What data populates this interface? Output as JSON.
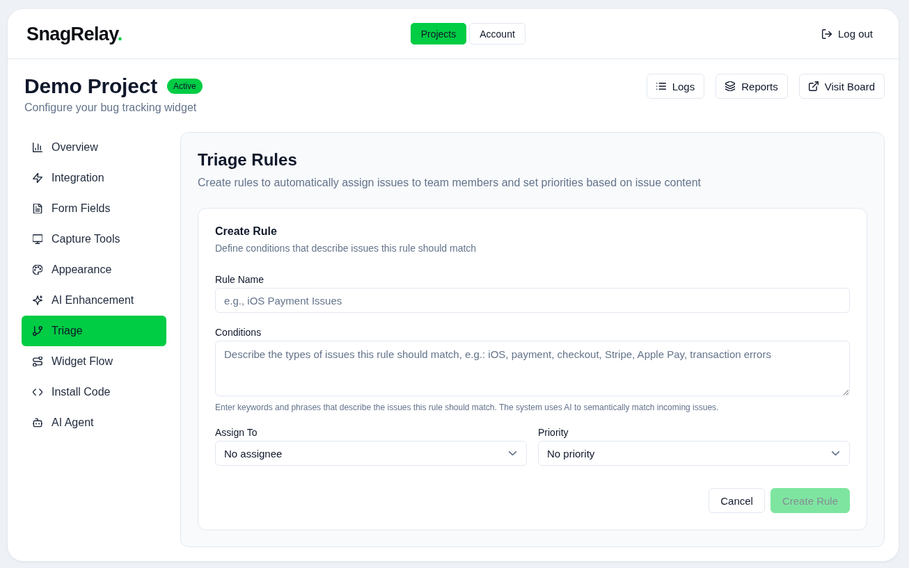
{
  "header": {
    "logo": {
      "name": "SnagRelay",
      "dot": "."
    },
    "nav_tabs": [
      {
        "label": "Projects",
        "selected": true
      },
      {
        "label": "Account",
        "selected": false
      }
    ],
    "logout": "Log out"
  },
  "project": {
    "title": "Demo Project",
    "status": "Active",
    "subtitle": "Configure your bug tracking widget",
    "actions": [
      "Logs",
      "Reports",
      "Visit Board"
    ]
  },
  "sidebar": {
    "items": [
      {
        "label": "Overview",
        "selected": false
      },
      {
        "label": "Integration",
        "selected": false
      },
      {
        "label": "Form Fields",
        "selected": false
      },
      {
        "label": "Capture Tools",
        "selected": false
      },
      {
        "label": "Appearance",
        "selected": false
      },
      {
        "label": "AI Enhancement",
        "selected": false
      },
      {
        "label": "Triage",
        "selected": true
      },
      {
        "label": "Widget Flow",
        "selected": false
      },
      {
        "label": "Install Code",
        "selected": false
      },
      {
        "label": "AI Agent",
        "selected": false
      }
    ]
  },
  "panel": {
    "title": "Triage Rules",
    "subtitle": "Create rules to automatically assign issues to team members and set priorities based on issue content",
    "form": {
      "title": "Create Rule",
      "subtitle": "Define conditions that describe issues this rule should match",
      "fields": [
        {
          "kind": "input",
          "label": "Rule Name",
          "placeholder": "e.g., iOS Payment Issues"
        },
        {
          "kind": "textarea",
          "label": "Conditions",
          "placeholder": "Describe the types of issues this rule should match, e.g.: iOS, payment, checkout, Stripe, Apple Pay, transaction errors",
          "hint": "Enter keywords and phrases that describe the issues this rule should match. The system uses AI to semantically match incoming issues."
        }
      ],
      "selects": [
        {
          "label": "Assign To",
          "value": "No assignee"
        },
        {
          "label": "Priority",
          "value": "No priority"
        }
      ],
      "buttons": [
        {
          "label": "Cancel",
          "kind": "secondary",
          "disabled": false
        },
        {
          "label": "Create Rule",
          "kind": "primary",
          "disabled": true
        }
      ]
    }
  }
}
